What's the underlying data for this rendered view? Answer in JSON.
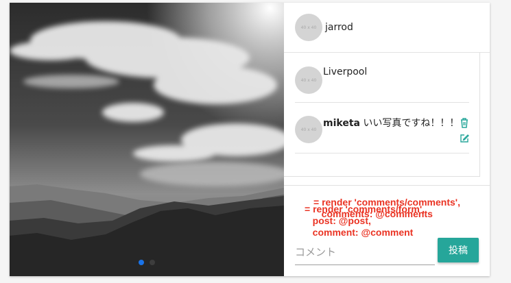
{
  "post": {
    "author": "jarrod",
    "avatar_placeholder": "40 x 40"
  },
  "comments": [
    {
      "user": "",
      "text": "Liverpool",
      "avatar_placeholder": "40 x 40"
    },
    {
      "user": "miketa",
      "text": "いい写真ですね！！！",
      "avatar_placeholder": "40 x 40",
      "actions": [
        "trash-icon",
        "edit-icon"
      ]
    }
  ],
  "annotations": {
    "comments_render": "= render 'comments/comments',\n   comments: @comments",
    "form_render": "= render 'comments/form',\n   post: @post,\n   comment: @comment"
  },
  "form": {
    "placeholder": "コメント",
    "submit_label": "投稿"
  },
  "carousel": {
    "dots": 2,
    "active_index": 0
  },
  "colors": {
    "annotation": "#ea3323",
    "accent": "#26a69a",
    "active_dot": "#1a73e8"
  }
}
